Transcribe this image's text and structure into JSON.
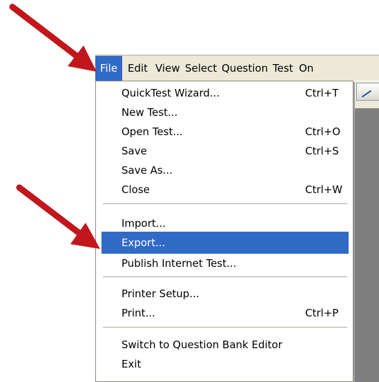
{
  "menubar": {
    "items": [
      {
        "label": "File",
        "active": true
      },
      {
        "label": "Edit",
        "active": false
      },
      {
        "label": "View",
        "active": false
      },
      {
        "label": "Select",
        "active": false
      },
      {
        "label": "Question",
        "active": false
      },
      {
        "label": "Test",
        "active": false
      },
      {
        "label": "On",
        "active": false
      }
    ]
  },
  "file_menu": {
    "items": [
      {
        "label": "QuickTest Wizard...",
        "shortcut": "Ctrl+T"
      },
      {
        "label": "New Test...",
        "shortcut": ""
      },
      {
        "label": "Open Test...",
        "shortcut": "Ctrl+O"
      },
      {
        "label": "Save",
        "shortcut": "Ctrl+S"
      },
      {
        "label": "Save As...",
        "shortcut": ""
      },
      {
        "label": "Close",
        "shortcut": "Ctrl+W"
      },
      {
        "label": "Import...",
        "shortcut": ""
      },
      {
        "label": "Export...",
        "shortcut": "",
        "highlighted": true
      },
      {
        "label": "Publish Internet Test...",
        "shortcut": ""
      },
      {
        "label": "Printer Setup...",
        "shortcut": ""
      },
      {
        "label": "Print...",
        "shortcut": "Ctrl+P"
      },
      {
        "label": "Switch to Question Bank Editor",
        "shortcut": ""
      },
      {
        "label": "Exit",
        "shortcut": ""
      }
    ]
  },
  "colors": {
    "highlight": "#316ac5",
    "arrow": "#c0161c",
    "menubar_bg": "#ece9d8"
  },
  "icons": {
    "annotation_arrows": [
      "arrow-to-file-menu",
      "arrow-to-export-item"
    ]
  }
}
